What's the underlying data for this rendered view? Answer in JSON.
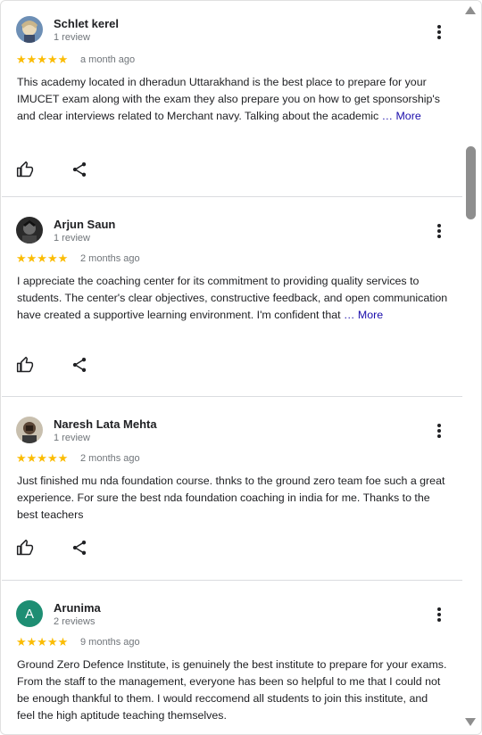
{
  "reviews": [
    {
      "name": "Schlet kerel",
      "count": "1 review",
      "stars": "★★★★★",
      "date": "a month ago",
      "text": "This academy located in dheradun Uttarakhand is the best place to prepare for your IMUCET exam along with the exam they also prepare you on how to get sponsorship's and clear interviews related to Merchant navy. Talking about the academic ",
      "more": "… More",
      "avatar": "photo-cartoon"
    },
    {
      "name": "Arjun Saun",
      "count": "1 review",
      "stars": "★★★★★",
      "date": "2 months ago",
      "text": "I appreciate the coaching center for its commitment to providing quality services to students. The center's clear objectives, constructive feedback, and open communication have created a supportive learning environment. I'm confident that ",
      "more": "… More",
      "avatar": "photo-dark"
    },
    {
      "name": "Naresh Lata Mehta",
      "count": "1 review",
      "stars": "★★★★★",
      "date": "2 months ago",
      "text": "Just finished mu nda foundation course. thnks to the ground zero team foe such a great experience. For sure the best nda foundation coaching in india for me. Thanks to the best teachers",
      "more": "",
      "avatar": "photo-person"
    },
    {
      "name": "Arunima",
      "count": "2 reviews",
      "stars": "★★★★★",
      "date": "9 months ago",
      "text": "Ground Zero Defence Institute, is genuinely the best institute to prepare for your exams. From the staff to the management, everyone has been so helpful to me that I could not be enough thankful to them. I would reccomend all students to join this institute, and feel the high aptitude teaching themselves.",
      "more": "",
      "avatar_letter": "A",
      "avatar_color": "#1e8e73"
    }
  ],
  "colors": {
    "star": "#fbbc04",
    "link": "#1a0dab",
    "divider": "#dadce0",
    "muted": "#70757a"
  },
  "icons": [
    "thumbs-up-icon",
    "share-icon",
    "more-vert-icon",
    "scroll-up-arrow-icon",
    "scroll-down-arrow-icon"
  ]
}
